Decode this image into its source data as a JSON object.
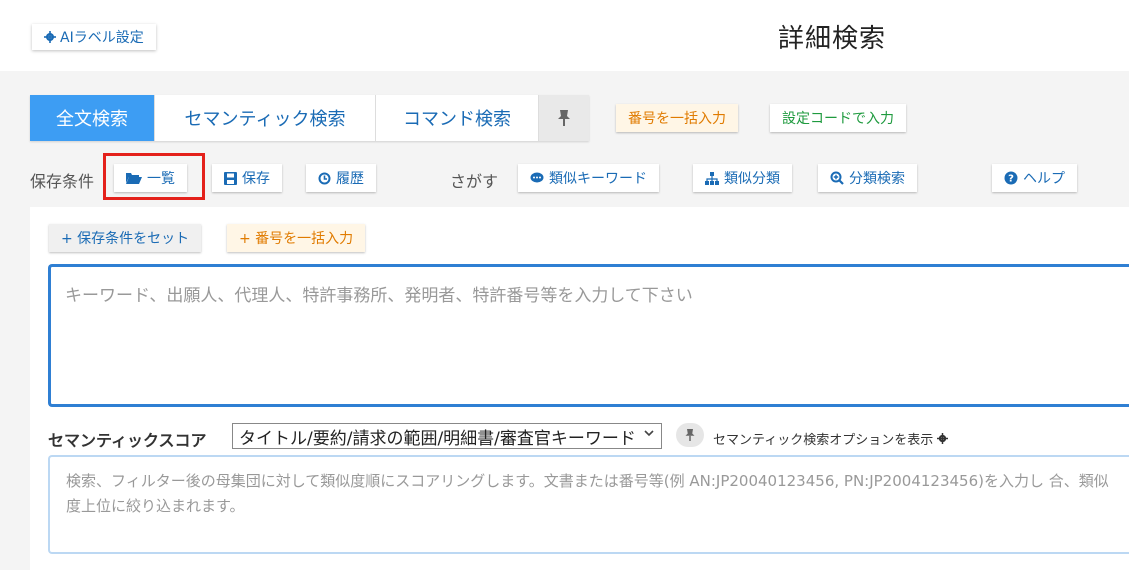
{
  "header": {
    "ai_label_button": "AIラベル設定",
    "title": "詳細検索"
  },
  "tabs": [
    {
      "label": "全文検索",
      "active": true
    },
    {
      "label": "セマンティック検索",
      "active": false
    },
    {
      "label": "コマンド検索",
      "active": false
    }
  ],
  "top_actions": {
    "bulk_number": "番号を一括入力",
    "setting_code": "設定コードで入力"
  },
  "saved_conditions": {
    "label": "保存条件",
    "list_button": "一覧",
    "save_button": "保存",
    "history_button": "履歴"
  },
  "search_tools": {
    "label": "さがす",
    "similar_keyword": "類似キーワード",
    "similar_class": "類似分類",
    "class_search": "分類検索",
    "help": "ヘルプ"
  },
  "card": {
    "set_condition": "+ 保存条件をセット",
    "bulk_number": "+ 番号を一括入力",
    "keyword_placeholder": "キーワード、出願人、代理人、特許事務所、発明者、特許番号等を入力して下さい",
    "semantic_label": "セマンティックスコア",
    "semantic_select": "タイトル/要約/請求の範囲/明細書/審査官キーワード",
    "semantic_option": "セマンティック検索オプションを表示",
    "semantic_placeholder": "検索、フィルター後の母集団に対して類似度順にスコアリングします。文書または番号等(例 AN:JP20040123456, PN:JP2004123456)を入力し 合、類似度上位に絞り込まれます。"
  },
  "colors": {
    "accent": "#3d9df3",
    "link": "#1a6bb5",
    "highlight": "#e4211b"
  }
}
